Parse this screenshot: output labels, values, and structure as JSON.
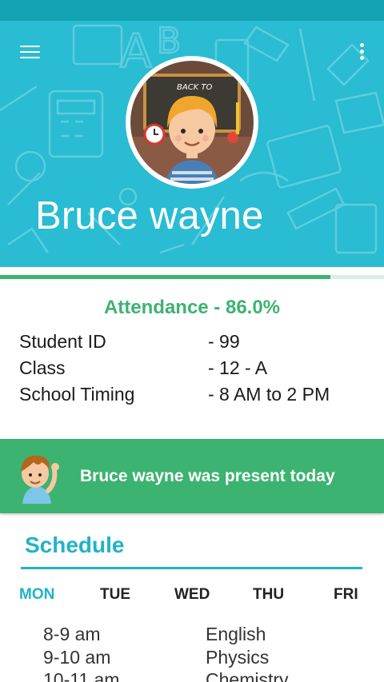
{
  "colors": {
    "status_bar": "#14a3b5",
    "header_bg": "#29bcd3",
    "accent_green": "#3cb371",
    "accent_teal": "#1fb3c9"
  },
  "header": {
    "menu_icon": "hamburger-menu-icon",
    "more_icon": "vertical-dots-icon",
    "avatar_icon": "student-avatar",
    "avatar_sign": "BACK TO",
    "name": "Bruce wayne"
  },
  "attendance": {
    "label": "Attendance",
    "separator": " - ",
    "percent": "86.0%",
    "progress": 0.86
  },
  "info": [
    {
      "label": "Student ID",
      "value": "- 99"
    },
    {
      "label": "Class",
      "value": "- 12 - A"
    },
    {
      "label": "School Timing",
      "value": "- 8 AM to 2 PM"
    }
  ],
  "banner": {
    "icon": "waving-kid-icon",
    "message": "Bruce wayne was present today"
  },
  "schedule": {
    "title": "Schedule",
    "days": [
      "MON",
      "TUE",
      "WED",
      "THU",
      "FRI"
    ],
    "active_day": "MON",
    "rows": [
      {
        "time": "8-9 am",
        "subject": "English"
      },
      {
        "time": "9-10 am",
        "subject": "Physics"
      },
      {
        "time": "10-11 am",
        "subject": "Chemistry"
      }
    ]
  }
}
